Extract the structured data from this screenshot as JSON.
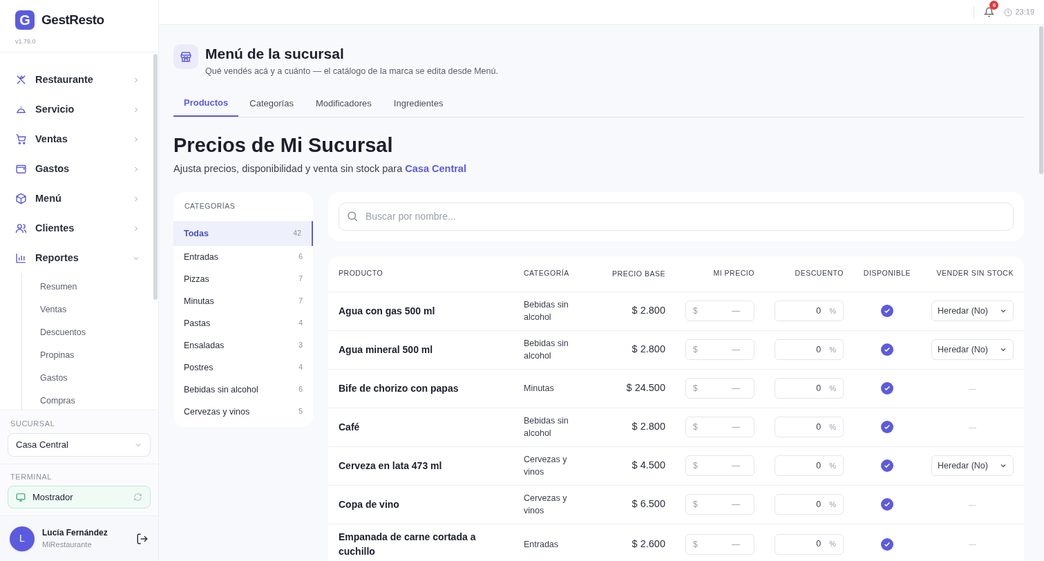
{
  "brand": {
    "logo_letter": "G",
    "name": "GestResto",
    "version": "v1.79.0"
  },
  "nav": [
    {
      "label": "Restaurante",
      "expanded": false
    },
    {
      "label": "Servicio",
      "expanded": false
    },
    {
      "label": "Ventas",
      "expanded": false
    },
    {
      "label": "Gastos",
      "expanded": false
    },
    {
      "label": "Menú",
      "expanded": false
    },
    {
      "label": "Clientes",
      "expanded": false
    },
    {
      "label": "Reportes",
      "expanded": true,
      "children": [
        {
          "label": "Resumen"
        },
        {
          "label": "Ventas"
        },
        {
          "label": "Descuentos"
        },
        {
          "label": "Propinas"
        },
        {
          "label": "Gastos"
        },
        {
          "label": "Compras"
        }
      ]
    }
  ],
  "branch": {
    "label": "SUCURSAL",
    "value": "Casa Central"
  },
  "terminal": {
    "label": "TERMINAL",
    "value": "Mostrador"
  },
  "user": {
    "initial": "L",
    "name": "Lucía Fernández",
    "org": "MiRestaurante"
  },
  "topbar": {
    "notifications": "6",
    "time": "23:19"
  },
  "header": {
    "title": "Menú de la sucursal",
    "subtitle": "Qué vendés acá y a cuánto — el catálogo de la marca se edita desde Menú."
  },
  "tabs": [
    {
      "label": "Productos",
      "selected": true
    },
    {
      "label": "Categorías",
      "selected": false
    },
    {
      "label": "Modificadores",
      "selected": false
    },
    {
      "label": "Ingredientes",
      "selected": false
    }
  ],
  "page": {
    "title": "Precios de Mi Sucursal",
    "subtitle": "Ajusta precios, disponibilidad y venta sin stock para",
    "branch_link": "Casa Central"
  },
  "categories": {
    "title": "CATEGORÍAS",
    "items": [
      {
        "label": "Todas",
        "count": "42",
        "selected": true
      },
      {
        "label": "Entradas",
        "count": "6",
        "selected": false
      },
      {
        "label": "Pizzas",
        "count": "7",
        "selected": false
      },
      {
        "label": "Minutas",
        "count": "7",
        "selected": false
      },
      {
        "label": "Pastas",
        "count": "4",
        "selected": false
      },
      {
        "label": "Ensaladas",
        "count": "3",
        "selected": false
      },
      {
        "label": "Postres",
        "count": "4",
        "selected": false
      },
      {
        "label": "Bebidas sin alcohol",
        "count": "6",
        "selected": false
      },
      {
        "label": "Cervezas y vinos",
        "count": "5",
        "selected": false
      }
    ]
  },
  "search": {
    "placeholder": "Buscar por nombre..."
  },
  "table": {
    "columns": [
      "PRODUCTO",
      "CATEGORÍA",
      "PRECIO BASE",
      "MI PRECIO",
      "DESCUENTO",
      "DISPONIBLE",
      "VENDER SIN STOCK"
    ],
    "rows": [
      {
        "product": "Agua con gas 500 ml",
        "category": "Bebidas sin alcohol",
        "base_price": "$ 2.800",
        "my_price": {
          "prefix": "$",
          "placeholder": "—"
        },
        "discount": {
          "value": "0",
          "suffix": "%"
        },
        "available": true,
        "sell_without_stock": {
          "kind": "select",
          "text": "Heredar (No)"
        }
      },
      {
        "product": "Agua mineral 500 ml",
        "category": "Bebidas sin alcohol",
        "base_price": "$ 2.800",
        "my_price": {
          "prefix": "$",
          "placeholder": "—"
        },
        "discount": {
          "value": "0",
          "suffix": "%"
        },
        "available": true,
        "sell_without_stock": {
          "kind": "select",
          "text": "Heredar (No)"
        }
      },
      {
        "product": "Bife de chorizo con papas",
        "category": "Minutas",
        "base_price": "$ 24.500",
        "my_price": {
          "prefix": "$",
          "placeholder": "—"
        },
        "discount": {
          "value": "0",
          "suffix": "%"
        },
        "available": true,
        "sell_without_stock": {
          "kind": "none",
          "text": "—"
        }
      },
      {
        "product": "Café",
        "category": "Bebidas sin alcohol",
        "base_price": "$ 2.800",
        "my_price": {
          "prefix": "$",
          "placeholder": "—"
        },
        "discount": {
          "value": "0",
          "suffix": "%"
        },
        "available": true,
        "sell_without_stock": {
          "kind": "none",
          "text": "—"
        }
      },
      {
        "product": "Cerveza en lata 473 ml",
        "category": "Cervezas y vinos",
        "base_price": "$ 4.500",
        "my_price": {
          "prefix": "$",
          "placeholder": "—"
        },
        "discount": {
          "value": "0",
          "suffix": "%"
        },
        "available": true,
        "sell_without_stock": {
          "kind": "select",
          "text": "Heredar (No)"
        }
      },
      {
        "product": "Copa de vino",
        "category": "Cervezas y vinos",
        "base_price": "$ 6.500",
        "my_price": {
          "prefix": "$",
          "placeholder": "—"
        },
        "discount": {
          "value": "0",
          "suffix": "%"
        },
        "available": true,
        "sell_without_stock": {
          "kind": "none",
          "text": "—"
        }
      },
      {
        "product": "Empanada de carne cortada a cuchillo",
        "category": "Entradas",
        "base_price": "$ 2.600",
        "my_price": {
          "prefix": "$",
          "placeholder": "—"
        },
        "discount": {
          "value": "0",
          "suffix": "%"
        },
        "available": true,
        "sell_without_stock": {
          "kind": "none",
          "text": "—"
        }
      }
    ]
  }
}
